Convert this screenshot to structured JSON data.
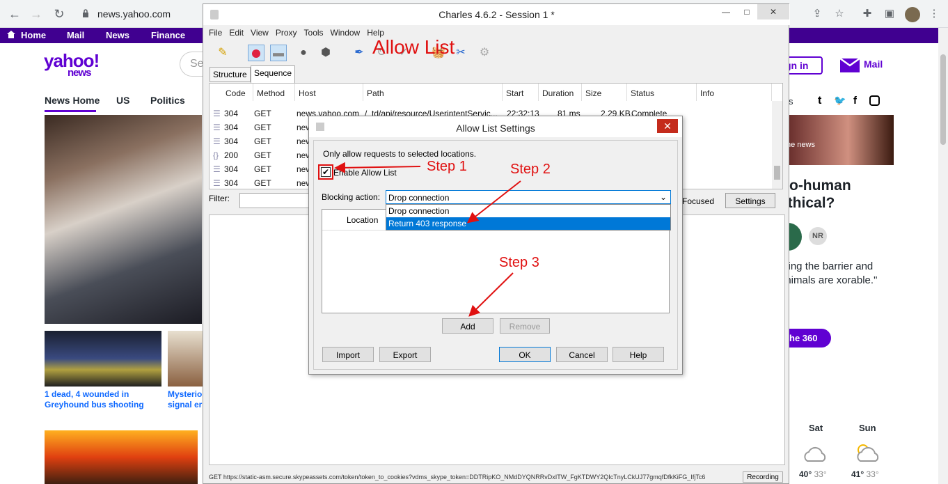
{
  "browser": {
    "url": "news.yahoo.com",
    "back_icon": "←",
    "forward_icon": "→",
    "reload_icon": "↻"
  },
  "yahoo": {
    "nav": [
      "Home",
      "Mail",
      "News",
      "Finance"
    ],
    "logo": "yahoo!",
    "logo_sub": "news",
    "search_placeholder": "Se",
    "subnav": [
      "News Home",
      "US",
      "Politics"
    ],
    "sign_in": "gn in",
    "mail": "Mail",
    "social_prefix": "s",
    "captions": [
      "1 dead, 4 wounded in Greyhound bus shooting",
      "Mysterio signal er"
    ],
    "pig_caption": "he news",
    "headline": "-to-human ethical?",
    "quote": "ating the barrier and animals are xorable.\"",
    "nr": "NR",
    "pill": "he 360",
    "weather": [
      {
        "day": "Sat",
        "high": "40°",
        "low": "33°"
      },
      {
        "day": "Sun",
        "high": "41°",
        "low": "33°"
      }
    ]
  },
  "charles": {
    "title": "Charles 4.6.2 - Session 1 *",
    "menu": [
      "File",
      "Edit",
      "View",
      "Proxy",
      "Tools",
      "Window",
      "Help"
    ],
    "annotation_title": "Allow List",
    "tabs": [
      "Structure",
      "Sequence"
    ],
    "columns": [
      "Code",
      "Method",
      "Host",
      "Path",
      "Start",
      "Duration",
      "Size",
      "Status",
      "Info"
    ],
    "rows": [
      {
        "code": "304",
        "method": "GET",
        "host": "news.yahoo.com",
        "path": "/_td/api/resource/UserintentServic...",
        "start": "22:32:13",
        "duration": "81 ms",
        "size": "2.29 KB",
        "status": "Complete"
      },
      {
        "code": "304",
        "method": "GET",
        "host": "new"
      },
      {
        "code": "304",
        "method": "GET",
        "host": "new"
      },
      {
        "code": "200",
        "method": "GET",
        "host": "new"
      },
      {
        "code": "304",
        "method": "GET",
        "host": "new"
      },
      {
        "code": "304",
        "method": "GET",
        "host": "new"
      }
    ],
    "filter_label": "Filter:",
    "focused_label": "Focused",
    "settings_button": "Settings",
    "status_url": "GET https://static-asm.secure.skypeassets.com/token/token_to_cookies?vdms_skype_token=DDTRipKO_NMdDYQNRRvDxITW_FgKTDWY2QIcTnyLCkUJ77gmqfDfkKiFG_IfjTc6",
    "recording": "Recording"
  },
  "dialog": {
    "title": "Allow List Settings",
    "intro": "Only allow requests to selected locations.",
    "enable_label": "Enable Allow List",
    "enabled": true,
    "blocking_label": "Blocking action:",
    "blocking_value": "Drop connection",
    "options": [
      "Drop connection",
      "Return 403 response"
    ],
    "location_header": "Location",
    "add": "Add",
    "remove": "Remove",
    "import": "Import",
    "export": "Export",
    "ok": "OK",
    "cancel": "Cancel",
    "help": "Help"
  },
  "annotations": {
    "step1": "Step 1",
    "step2": "Step 2",
    "step3": "Step 3",
    "color": "#e01010"
  }
}
